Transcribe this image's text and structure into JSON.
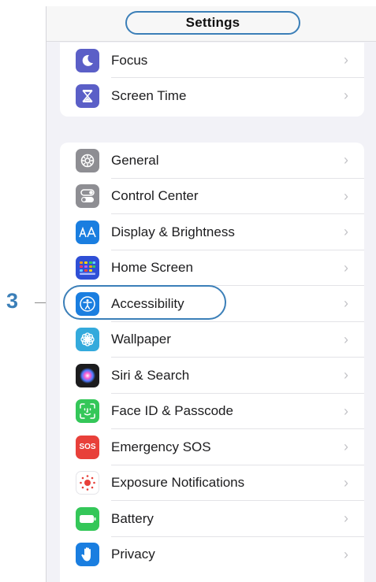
{
  "nav": {
    "title": "Settings"
  },
  "callout": {
    "number": "3"
  },
  "groups": [
    {
      "items": [
        {
          "label": "Focus",
          "icon": "moon-icon",
          "color": "#5b5fc7"
        },
        {
          "label": "Screen Time",
          "icon": "hourglass-icon",
          "color": "#5b5fc7"
        }
      ]
    },
    {
      "items": [
        {
          "label": "General",
          "icon": "gear-icon",
          "color": "#8e8e93"
        },
        {
          "label": "Control Center",
          "icon": "toggles-icon",
          "color": "#8e8e93"
        },
        {
          "label": "Display & Brightness",
          "icon": "text-size-icon",
          "color": "#1a7ee0"
        },
        {
          "label": "Home Screen",
          "icon": "app-grid-icon",
          "color": "#2f4fd6"
        },
        {
          "label": "Accessibility",
          "icon": "accessibility-icon",
          "color": "#1a7ee0"
        },
        {
          "label": "Wallpaper",
          "icon": "flower-icon",
          "color": "#34aadc"
        },
        {
          "label": "Siri & Search",
          "icon": "siri-icon",
          "color": "#1c1c1e"
        },
        {
          "label": "Face ID & Passcode",
          "icon": "face-id-icon",
          "color": "#34c759"
        },
        {
          "label": "Emergency SOS",
          "icon": "sos-icon",
          "color": "#e8403a",
          "icon_text": "SOS"
        },
        {
          "label": "Exposure Notifications",
          "icon": "exposure-icon",
          "color": "#ffffff"
        },
        {
          "label": "Battery",
          "icon": "battery-icon",
          "color": "#34c759"
        },
        {
          "label": "Privacy",
          "icon": "hand-icon",
          "color": "#1a7ee0"
        }
      ]
    }
  ]
}
